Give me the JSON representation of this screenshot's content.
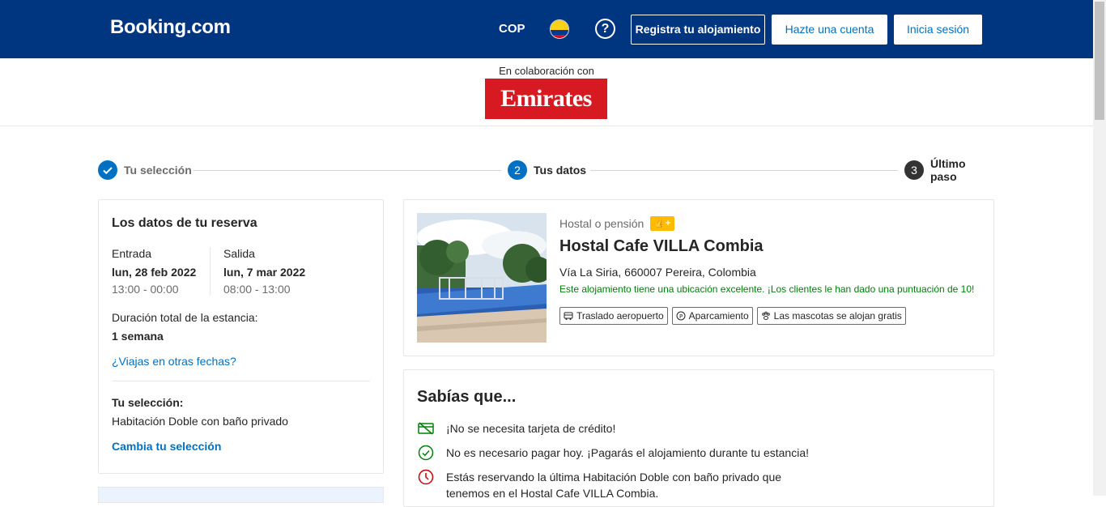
{
  "header": {
    "logo": "Booking.com",
    "currency": "COP",
    "help_symbol": "?",
    "register_label": "Registra tu alojamiento",
    "create_account_label": "Hazte una cuenta",
    "login_label": "Inicia sesión",
    "bg_color": "#003580"
  },
  "partner": {
    "caption": "En colaboración con",
    "name": "Emirates"
  },
  "steps": [
    {
      "label": "Tu selección",
      "icon": "check-icon"
    },
    {
      "label": "Tus datos",
      "number": "2"
    },
    {
      "label": "Último paso",
      "number": "3"
    }
  ],
  "booking_summary": {
    "title": "Los datos de tu reserva",
    "checkin_label": "Entrada",
    "checkin_date": "lun, 28 feb 2022",
    "checkin_time": "13:00 - 00:00",
    "checkout_label": "Salida",
    "checkout_date": "lun, 7 mar 2022",
    "checkout_time": "08:00 - 13:00",
    "duration_label": "Duración total de la estancia:",
    "duration_value": "1 semana",
    "other_dates_link": "¿Viajas en otras fechas?",
    "selection_label": "Tu selección:",
    "room": "Habitación Doble con baño privado",
    "change_selection_link": "Cambia tu selección"
  },
  "property": {
    "type": "Hostal o pensión",
    "name": "Hostal Cafe VILLA Combia",
    "address": "Vía La Siria, 660007 Pereira, Colombia",
    "location_note": "Este alojamiento tiene una ubicación excelente. ¡Los clientes le han dado una puntuación de 10!",
    "facilities": [
      "Traslado aeropuerto",
      "Aparcamiento",
      "Las mascotas se alojan gratis"
    ]
  },
  "did_you_know": {
    "title": "Sabías que...",
    "items": [
      {
        "text": "¡No se necesita tarjeta de crédito!",
        "icon": "no-credit-card-icon"
      },
      {
        "text": "No es necesario pagar hoy. ¡Pagarás el alojamiento durante tu estancia!",
        "icon": "check-circle-icon"
      },
      {
        "text": "Estás reservando la última Habitación Doble con baño privado que tenemos en el Hostal Cafe VILLA Combia.",
        "icon": "clock-icon"
      }
    ]
  },
  "colors": {
    "brand_blue": "#003580",
    "link_blue": "#0071c2",
    "success_green": "#008009",
    "alert_red": "#cc0000",
    "emirates_red": "#d71921"
  }
}
